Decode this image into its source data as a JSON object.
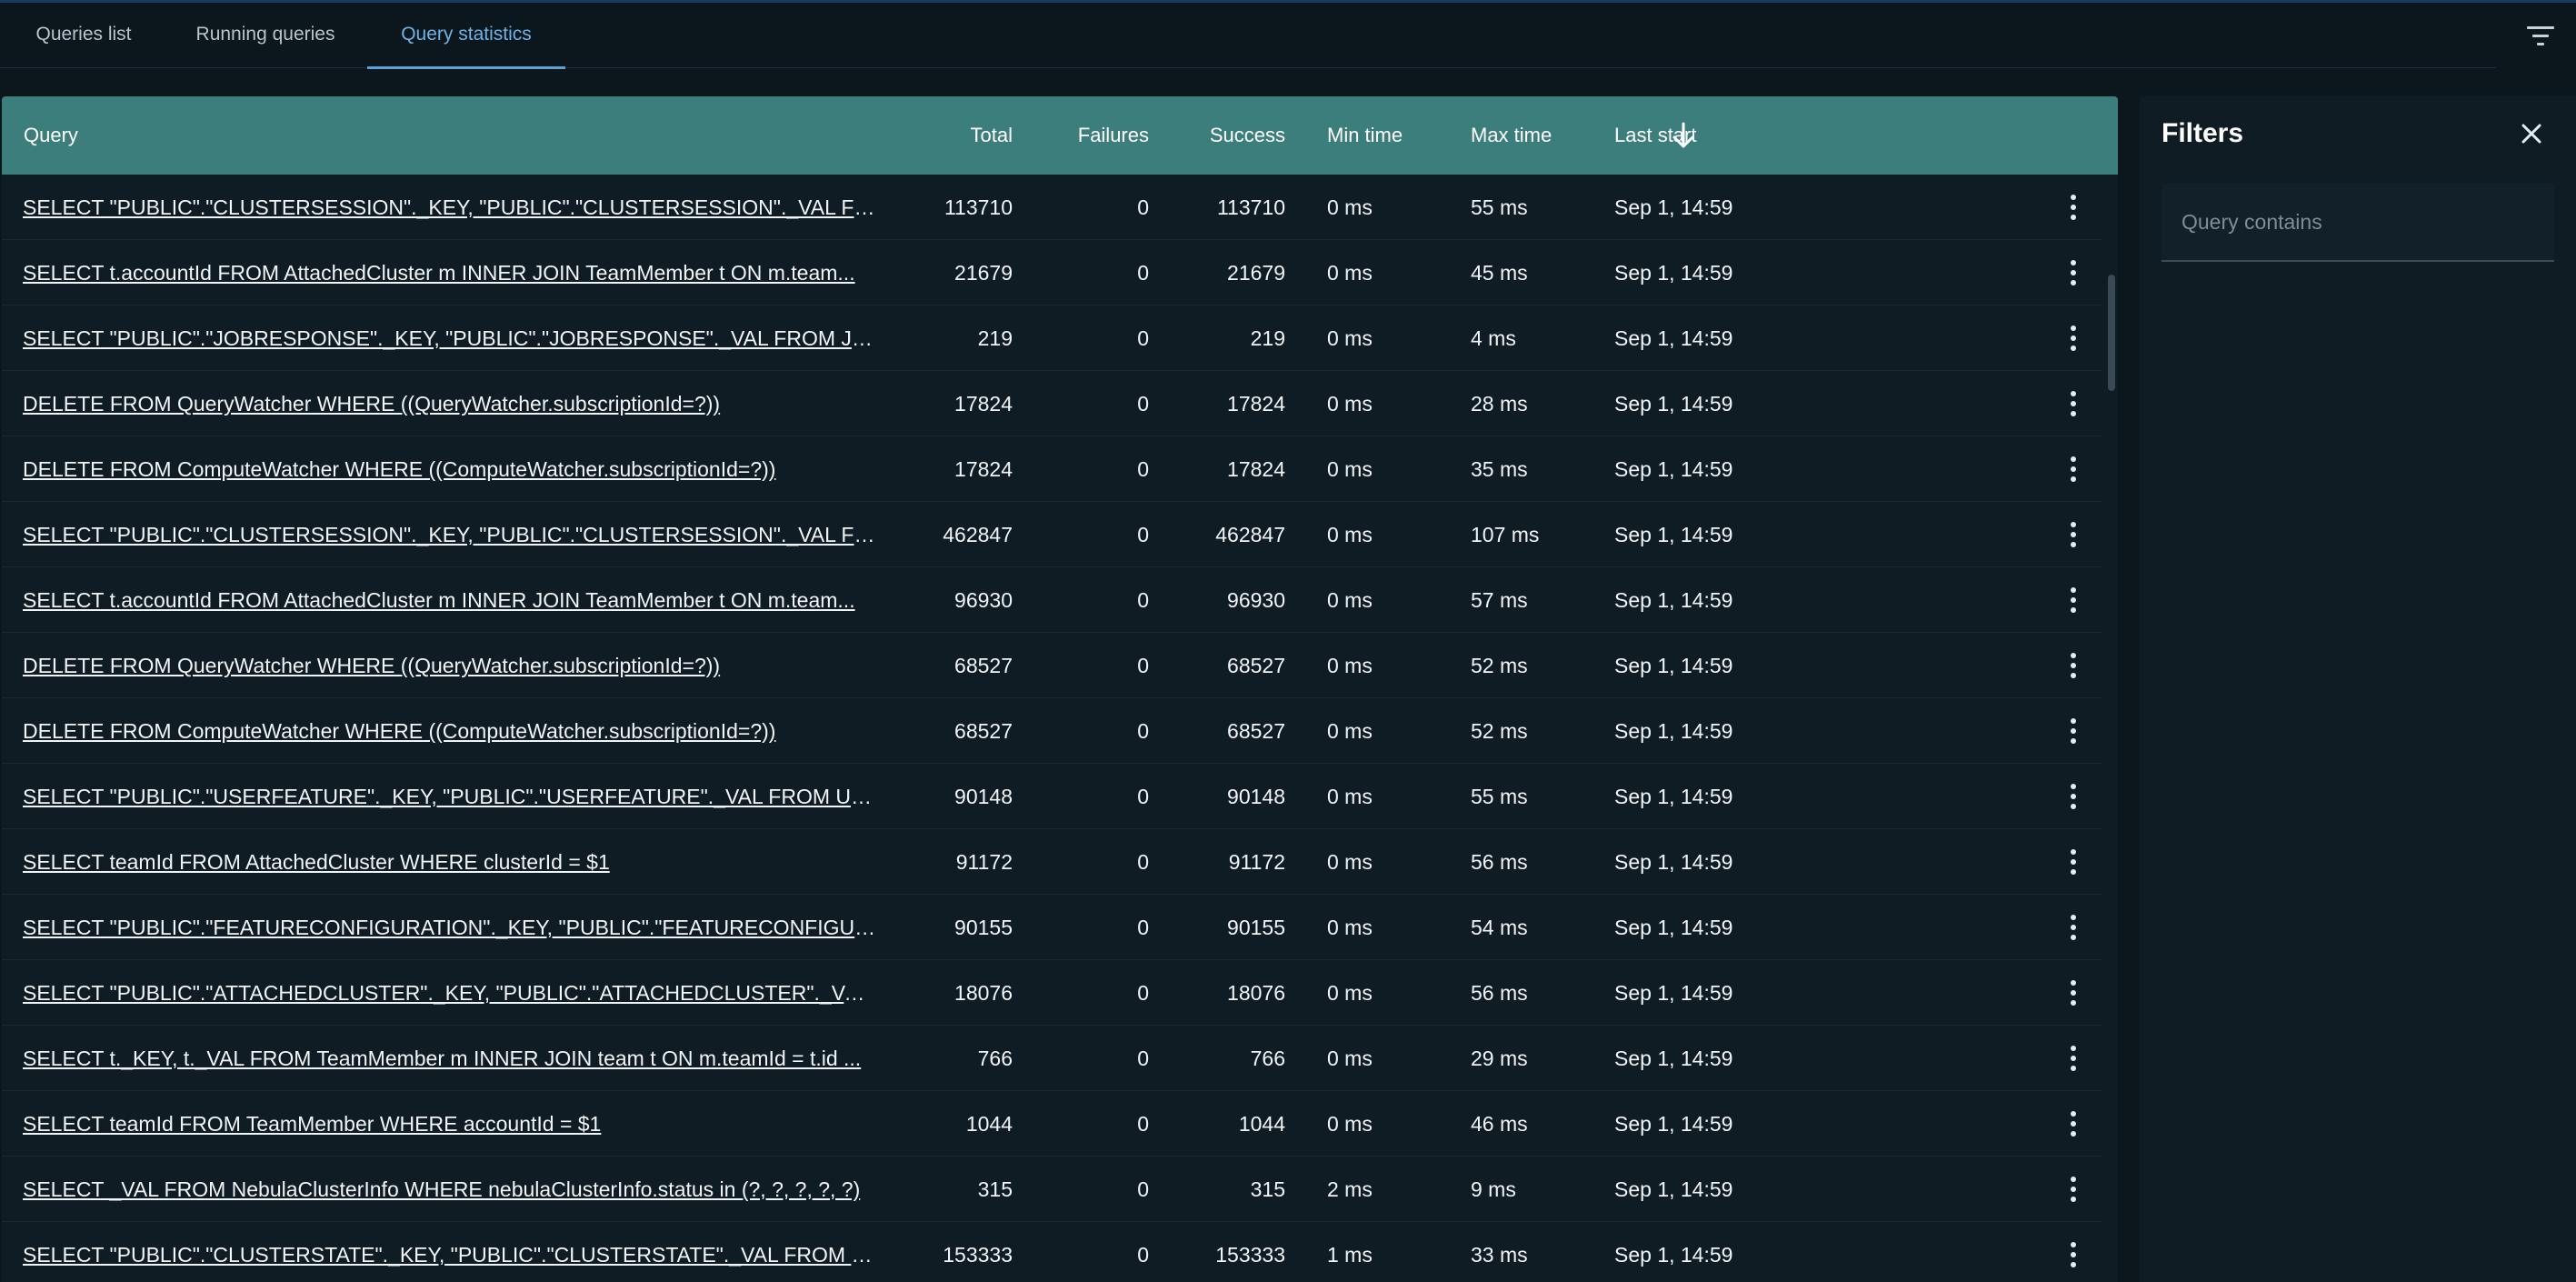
{
  "tabs": [
    {
      "label": "Queries list",
      "active": false
    },
    {
      "label": "Running queries",
      "active": false
    },
    {
      "label": "Query statistics",
      "active": true
    }
  ],
  "table": {
    "headers": {
      "query": "Query",
      "total": "Total",
      "failures": "Failures",
      "success": "Success",
      "min_time": "Min time",
      "max_time": "Max time",
      "last_start": "Last start"
    },
    "sort": {
      "column": "last_start",
      "direction": "descending",
      "icon": "arrow-down-icon"
    },
    "rows": [
      {
        "query": "SELECT \"PUBLIC\".\"CLUSTERSESSION\"._KEY, \"PUBLIC\".\"CLUSTERSESSION\"._VAL FROM ...",
        "total": "113710",
        "failures": "0",
        "success": "113710",
        "min_time": "0 ms",
        "max_time": "55 ms",
        "last_start": "Sep 1, 14:59"
      },
      {
        "query": "SELECT t.accountId FROM AttachedCluster m INNER JOIN TeamMember t ON m.team...",
        "total": "21679",
        "failures": "0",
        "success": "21679",
        "min_time": "0 ms",
        "max_time": "45 ms",
        "last_start": "Sep 1, 14:59"
      },
      {
        "query": "SELECT \"PUBLIC\".\"JOBRESPONSE\"._KEY, \"PUBLIC\".\"JOBRESPONSE\"._VAL FROM JobR...",
        "total": "219",
        "failures": "0",
        "success": "219",
        "min_time": "0 ms",
        "max_time": "4 ms",
        "last_start": "Sep 1, 14:59"
      },
      {
        "query": "DELETE FROM QueryWatcher WHERE ((QueryWatcher.subscriptionId=?))",
        "total": "17824",
        "failures": "0",
        "success": "17824",
        "min_time": "0 ms",
        "max_time": "28 ms",
        "last_start": "Sep 1, 14:59"
      },
      {
        "query": "DELETE FROM ComputeWatcher WHERE ((ComputeWatcher.subscriptionId=?))",
        "total": "17824",
        "failures": "0",
        "success": "17824",
        "min_time": "0 ms",
        "max_time": "35 ms",
        "last_start": "Sep 1, 14:59"
      },
      {
        "query": "SELECT \"PUBLIC\".\"CLUSTERSESSION\"._KEY, \"PUBLIC\".\"CLUSTERSESSION\"._VAL FROM ...",
        "total": "462847",
        "failures": "0",
        "success": "462847",
        "min_time": "0 ms",
        "max_time": "107 ms",
        "last_start": "Sep 1, 14:59"
      },
      {
        "query": "SELECT t.accountId FROM AttachedCluster m INNER JOIN TeamMember t ON m.team...",
        "total": "96930",
        "failures": "0",
        "success": "96930",
        "min_time": "0 ms",
        "max_time": "57 ms",
        "last_start": "Sep 1, 14:59"
      },
      {
        "query": "DELETE FROM QueryWatcher WHERE ((QueryWatcher.subscriptionId=?))",
        "total": "68527",
        "failures": "0",
        "success": "68527",
        "min_time": "0 ms",
        "max_time": "52 ms",
        "last_start": "Sep 1, 14:59"
      },
      {
        "query": "DELETE FROM ComputeWatcher WHERE ((ComputeWatcher.subscriptionId=?))",
        "total": "68527",
        "failures": "0",
        "success": "68527",
        "min_time": "0 ms",
        "max_time": "52 ms",
        "last_start": "Sep 1, 14:59"
      },
      {
        "query": "SELECT \"PUBLIC\".\"USERFEATURE\"._KEY, \"PUBLIC\".\"USERFEATURE\"._VAL FROM UserFe...",
        "total": "90148",
        "failures": "0",
        "success": "90148",
        "min_time": "0 ms",
        "max_time": "55 ms",
        "last_start": "Sep 1, 14:59"
      },
      {
        "query": "SELECT teamId FROM AttachedCluster WHERE clusterId = $1",
        "total": "91172",
        "failures": "0",
        "success": "91172",
        "min_time": "0 ms",
        "max_time": "56 ms",
        "last_start": "Sep 1, 14:59"
      },
      {
        "query": "SELECT \"PUBLIC\".\"FEATURECONFIGURATION\"._KEY, \"PUBLIC\".\"FEATURECONFIGURATI...",
        "total": "90155",
        "failures": "0",
        "success": "90155",
        "min_time": "0 ms",
        "max_time": "54 ms",
        "last_start": "Sep 1, 14:59"
      },
      {
        "query": "SELECT \"PUBLIC\".\"ATTACHEDCLUSTER\"._KEY, \"PUBLIC\".\"ATTACHEDCLUSTER\"._VAL FR...",
        "total": "18076",
        "failures": "0",
        "success": "18076",
        "min_time": "0 ms",
        "max_time": "56 ms",
        "last_start": "Sep 1, 14:59"
      },
      {
        "query": "SELECT t._KEY, t._VAL FROM TeamMember m INNER JOIN team t ON m.teamId = t.id ...",
        "total": "766",
        "failures": "0",
        "success": "766",
        "min_time": "0 ms",
        "max_time": "29 ms",
        "last_start": "Sep 1, 14:59"
      },
      {
        "query": "SELECT teamId FROM TeamMember WHERE accountId = $1",
        "total": "1044",
        "failures": "0",
        "success": "1044",
        "min_time": "0 ms",
        "max_time": "46 ms",
        "last_start": "Sep 1, 14:59"
      },
      {
        "query": "SELECT _VAL FROM NebulaClusterInfo WHERE nebulaClusterInfo.status in (?, ?, ?, ?, ?)",
        "total": "315",
        "failures": "0",
        "success": "315",
        "min_time": "2 ms",
        "max_time": "9 ms",
        "last_start": "Sep 1, 14:59"
      },
      {
        "query": "SELECT \"PUBLIC\".\"CLUSTERSTATE\"._KEY, \"PUBLIC\".\"CLUSTERSTATE\"._VAL FROM Clus...",
        "total": "153333",
        "failures": "0",
        "success": "153333",
        "min_time": "1 ms",
        "max_time": "33 ms",
        "last_start": "Sep 1, 14:59"
      }
    ],
    "row_menu_icon": "more-vertical-icon"
  },
  "filters": {
    "title": "Filters",
    "close_icon": "close-icon",
    "query_contains_placeholder": "Query contains",
    "query_contains_value": ""
  },
  "toolbar": {
    "filter_icon": "filter-list-icon"
  },
  "colors": {
    "background": "#0b161d",
    "panel": "#0f1c24",
    "table_header": "#3c7e7c",
    "active_tab": "#6fb3e6"
  }
}
